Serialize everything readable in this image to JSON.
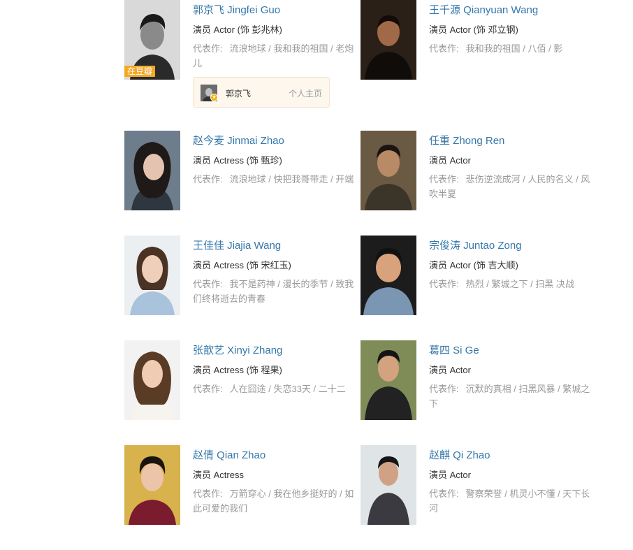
{
  "labels": {
    "works_prefix": "代表作:"
  },
  "cast": [
    {
      "name": "郭京飞 Jingfei Guo",
      "role": "演员 Actor (饰 彭兆林)",
      "works": "流浪地球 / 我和我的祖国 / 老炮儿",
      "tag": "在豆瓣",
      "photo": {
        "bg": "#d9d9d9",
        "skin": "#8a8a8a",
        "hair": "#1a1a1a",
        "cloth": "#2a2a2a"
      }
    },
    {
      "name": "王千源 Qianyuan Wang",
      "role": "演员 Actor (饰 邓立钢)",
      "works": "我和我的祖国 / 八佰 / 影",
      "photo": {
        "bg": "#2b2017",
        "skin": "#a06a48",
        "hair": "#120c08",
        "cloth": "#100c0a"
      }
    },
    {
      "name": "赵今麦 Jinmai Zhao",
      "role": "演员 Actress (饰 甄珍)",
      "works": "流浪地球 / 快把我哥带走 / 开端",
      "photo": {
        "bg": "#6e7d8c",
        "skin": "#e4c4b0",
        "hair": "#1f1a18",
        "cloth": "#2e3640"
      }
    },
    {
      "name": "任重 Zhong Ren",
      "role": "演员 Actor",
      "works": "悲伤逆流成河 / 人民的名义 / 风吹半夏",
      "photo": {
        "bg": "#6a5a44",
        "skin": "#b88a66",
        "hair": "#1b1511",
        "cloth": "#3b3428"
      }
    },
    {
      "name": "王佳佳 Jiajia Wang",
      "role": "演员 Actress (饰 宋红玉)",
      "works": "我不是药神 / 漫长的季节 / 致我们终将逝去的青春",
      "photo": {
        "bg": "#eceff1",
        "skin": "#efcfba",
        "hair": "#4a3324",
        "cloth": "#a9c3dc"
      }
    },
    {
      "name": "宗俊涛 Juntao Zong",
      "role": "演员 Actor (饰 吉大顺)",
      "works": "热烈 / 繁城之下 / 扫黑 决战",
      "photo": {
        "bg": "#1c1c1c",
        "skin": "#d8a27c",
        "hair": "#111111",
        "cloth": "#7b96b3"
      }
    },
    {
      "name": "张歆艺 Xinyi Zhang",
      "role": "演员 Actress (饰 程果)",
      "works": "人在囧途 / 失恋33天 / 二十二",
      "photo": {
        "bg": "#f2f2f2",
        "skin": "#f0ccb4",
        "hair": "#5a3b26",
        "cloth": "#f7f3ee"
      }
    },
    {
      "name": "葛四 Si Ge",
      "role": "演员 Actor",
      "works": "沉默的真相 / 扫黑风暴 / 繁城之下",
      "photo": {
        "bg": "#7f8c58",
        "skin": "#d3a27e",
        "hair": "#141414",
        "cloth": "#222222"
      }
    },
    {
      "name": "赵倩 Qian Zhao",
      "role": "演员 Actress",
      "works": "万箭穿心 / 我在他乡挺好的 / 如此可爱的我们",
      "photo": {
        "bg": "#d8b24c",
        "skin": "#ecc4aa",
        "hair": "#1a1410",
        "cloth": "#7a1b2e"
      }
    },
    {
      "name": "赵麒 Qi Zhao",
      "role": "演员 Actor",
      "works": "警察荣誉 / 机灵小不懂 / 天下长河",
      "photo": {
        "bg": "#dfe4e6",
        "skin": "#d0a285",
        "hair": "#151515",
        "cloth": "#3a3a40"
      }
    }
  ],
  "profile_card": {
    "name": "郭京飞",
    "link": "个人主页",
    "badge_icon": "star-badge-icon"
  }
}
